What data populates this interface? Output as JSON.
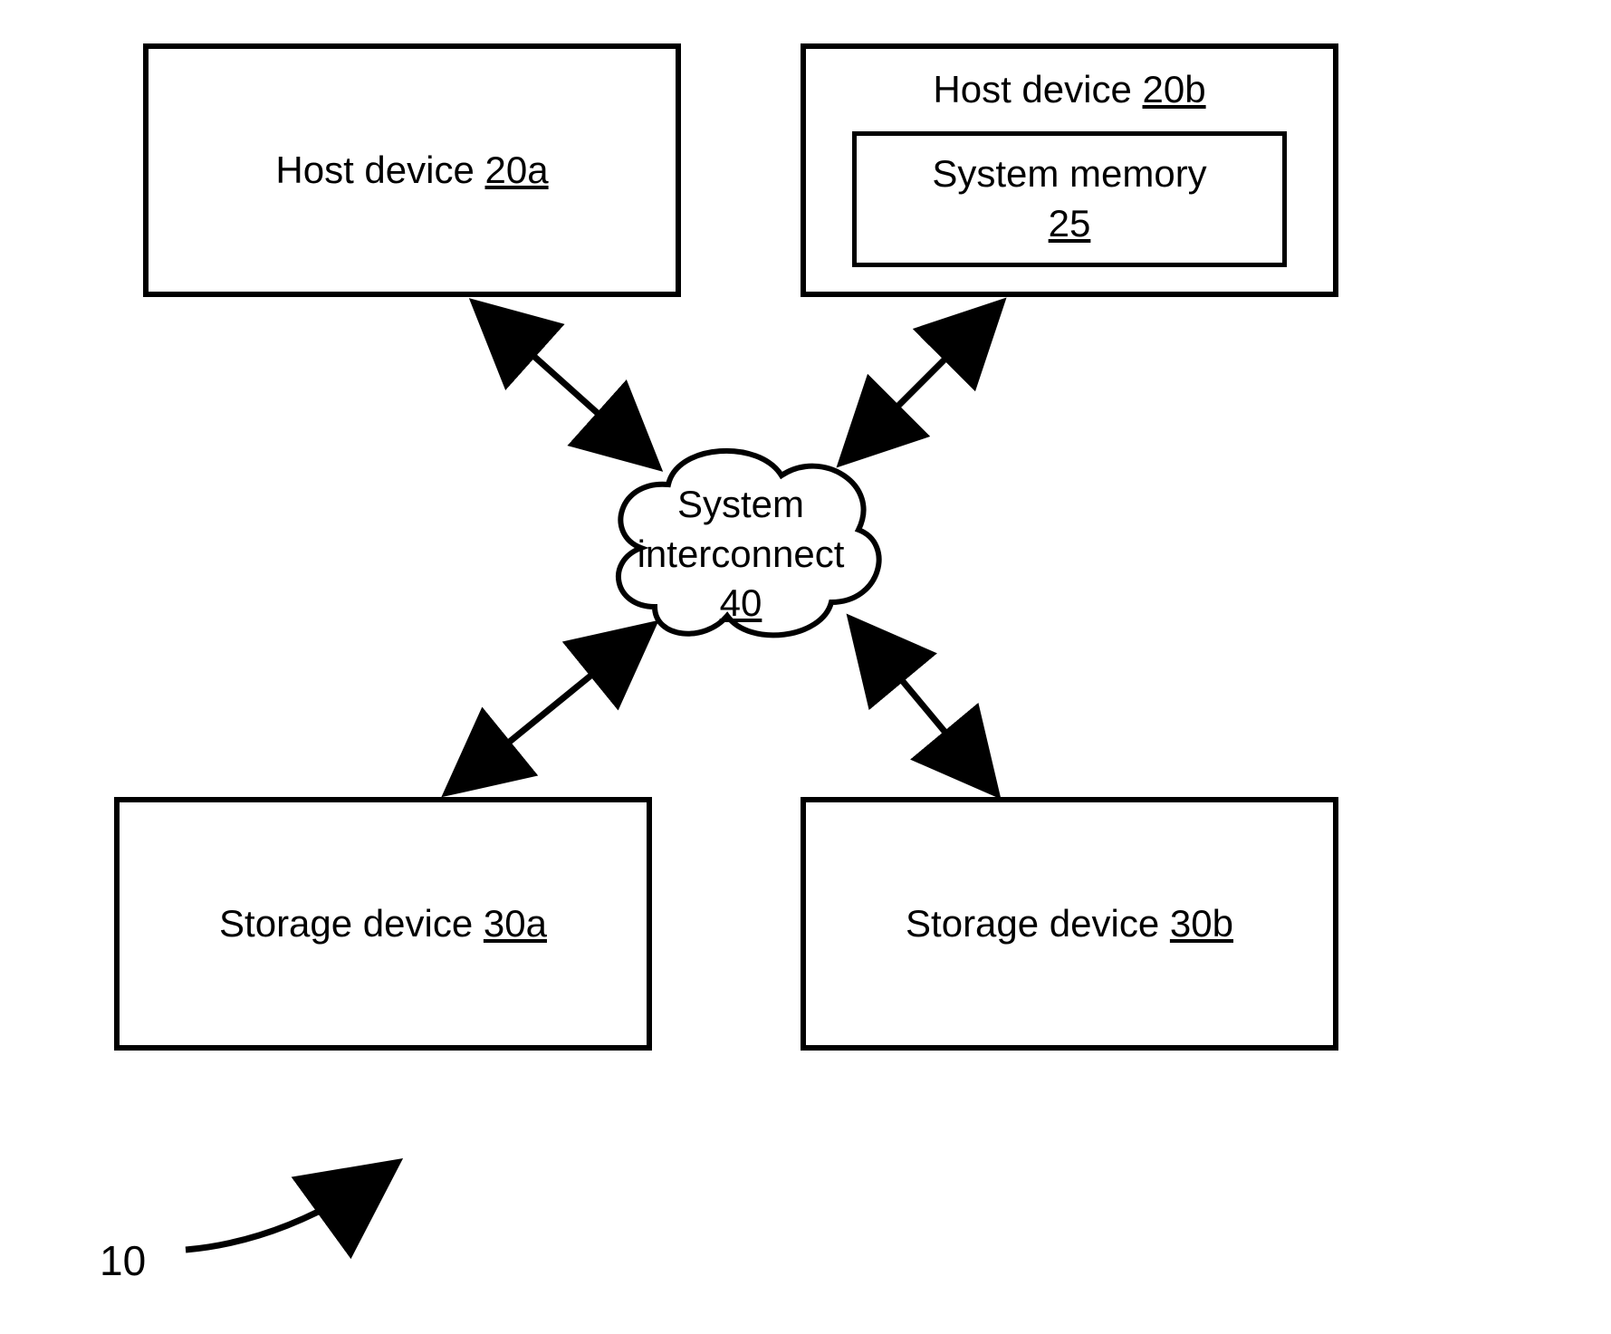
{
  "figure_ref": "10",
  "host_a": {
    "text": "Host device ",
    "ref": "20a"
  },
  "host_b": {
    "title_text": "Host device ",
    "title_ref": "20b",
    "mem_text": "System memory",
    "mem_ref": "25"
  },
  "cloud": {
    "line1": "System",
    "line2": "interconnect",
    "ref": "40"
  },
  "storage_a": {
    "text": "Storage device ",
    "ref": "30a"
  },
  "storage_b": {
    "text": "Storage device ",
    "ref": "30b"
  }
}
